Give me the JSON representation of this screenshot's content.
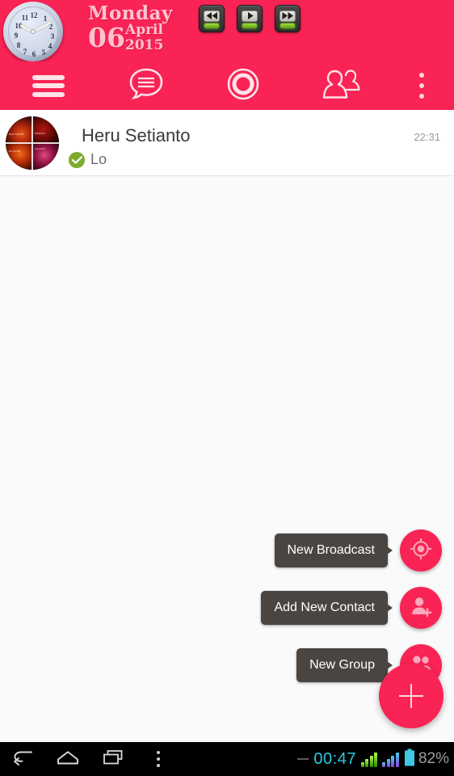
{
  "widgets": {
    "clock": {
      "name": "analog-clock",
      "numbers": [
        "12",
        "1",
        "2",
        "3",
        "4",
        "5",
        "6",
        "7",
        "8",
        "9",
        "10",
        "11"
      ]
    },
    "date": {
      "weekday": "Monday",
      "day": "06",
      "month": "April",
      "year": "2015"
    },
    "media": {
      "buttons": [
        {
          "name": "rewind-button",
          "icon": "rewind-icon"
        },
        {
          "name": "play-button",
          "icon": "play-icon"
        },
        {
          "name": "fast-forward-button",
          "icon": "fast-forward-icon"
        }
      ]
    }
  },
  "navbar": {
    "accent_color": "#FA2355",
    "items": [
      {
        "name": "menu-button",
        "icon": "hamburger-icon"
      },
      {
        "name": "chats-tab",
        "icon": "chat-bubble-icon"
      },
      {
        "name": "status-tab",
        "icon": "circle-icon"
      },
      {
        "name": "contacts-tab",
        "icon": "people-icon"
      },
      {
        "name": "overflow-button",
        "icon": "more-vertical-icon"
      }
    ]
  },
  "chat_list": {
    "rows": [
      {
        "name": "Heru Setianto",
        "message": "Lo",
        "time": "22:31",
        "status_icon": "check-circle-icon",
        "status_color": "#7CAB2E",
        "avatar": "photo-collage-avatar",
        "avatar_tiles": [
          "RED MOON",
          "NEBULA",
          "ECLIPSE",
          "GALAXY"
        ]
      }
    ]
  },
  "fab": {
    "main": {
      "label": "+",
      "name": "fab-main-button",
      "icon": "plus-icon",
      "color": "#FA2355"
    },
    "items": [
      {
        "label": "New Broadcast",
        "icon": "broadcast-icon",
        "name": "fab-new-broadcast"
      },
      {
        "label": "Add New Contact",
        "icon": "person-add-icon",
        "name": "fab-add-new-contact"
      },
      {
        "label": "New Group",
        "icon": "group-icon",
        "name": "fab-new-group"
      }
    ],
    "tooltip_color": "#4A4541"
  },
  "system_bar": {
    "buttons": [
      {
        "name": "back-button",
        "icon": "back-arrow-icon"
      },
      {
        "name": "home-button",
        "icon": "home-icon"
      },
      {
        "name": "recents-button",
        "icon": "recents-icon"
      },
      {
        "name": "sysmenu-button",
        "icon": "more-vertical-icon"
      }
    ],
    "clock": "00:47",
    "clock_color": "#2FC6E0",
    "battery_percent": "82%",
    "signal_bars": 4,
    "signal2_bars": 4
  }
}
